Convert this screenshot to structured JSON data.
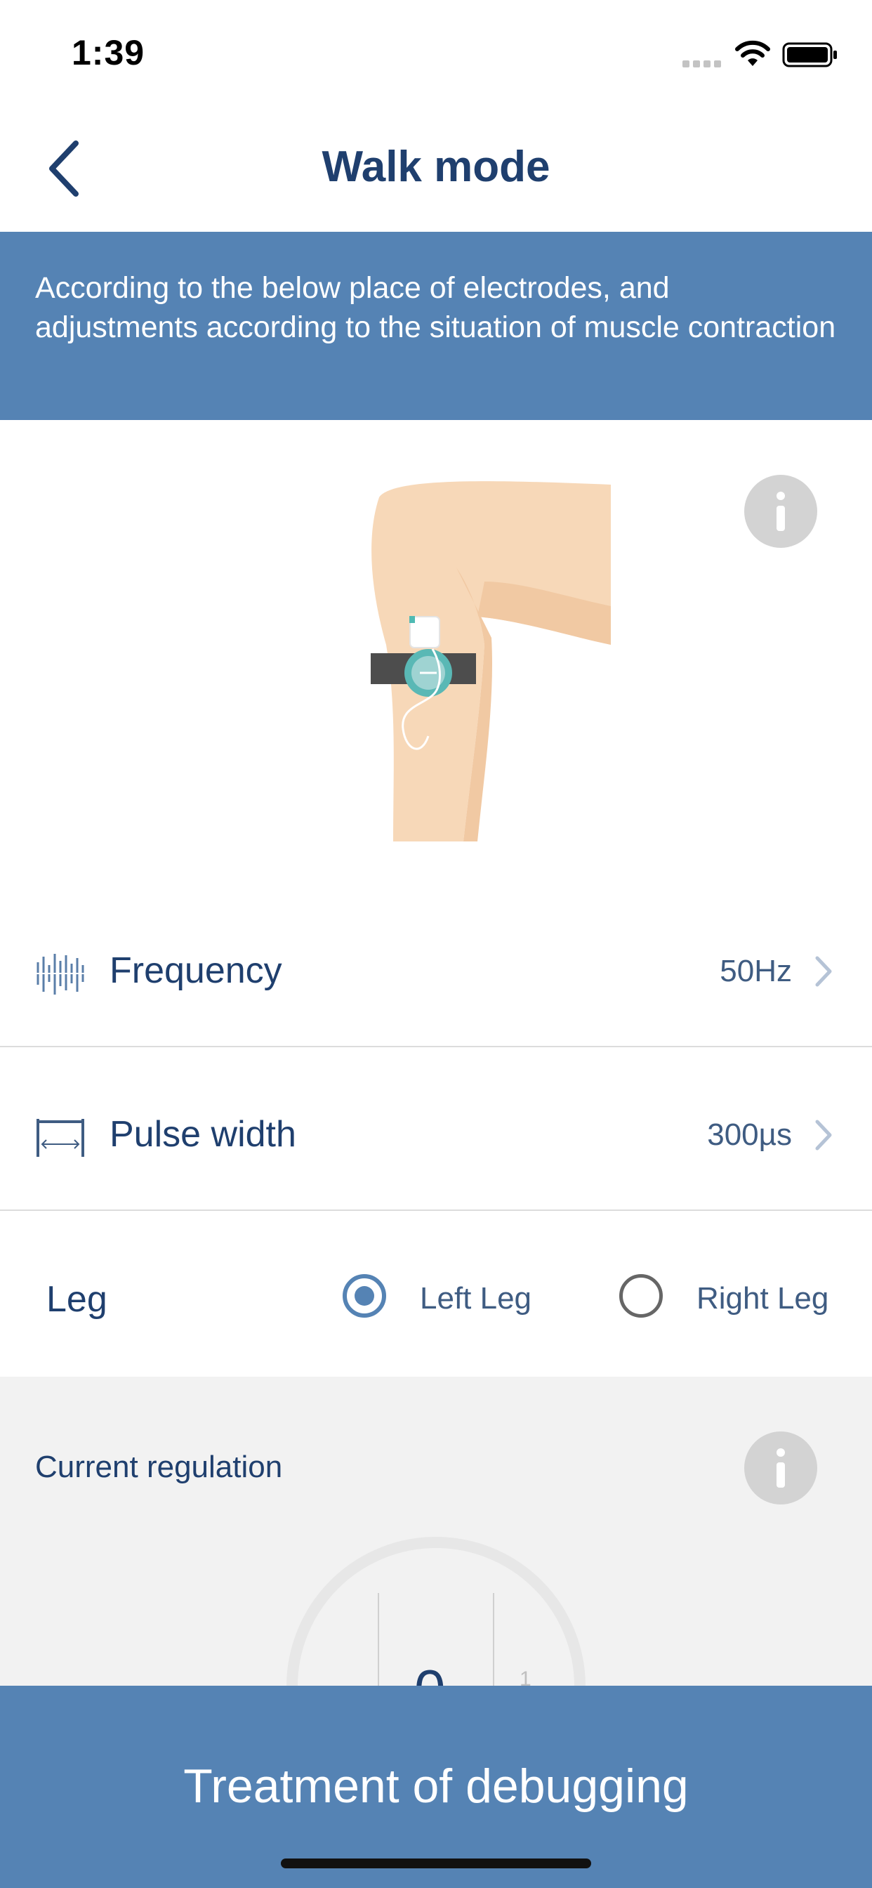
{
  "status_bar": {
    "time": "1:39"
  },
  "nav": {
    "title": "Walk mode",
    "back_icon": "chevron-left-icon"
  },
  "banner": {
    "text": "According to the below place of electrodes, and adjustments according to the situation of muscle contraction"
  },
  "illustration": {
    "icon": "leg-electrode-illustration",
    "info_icon": "info-icon"
  },
  "settings": [
    {
      "icon": "frequency-icon",
      "label": "Frequency",
      "value": "50Hz",
      "chevron": "chevron-right-icon"
    },
    {
      "icon": "pulse-width-icon",
      "label": "Pulse width",
      "value": "300µs",
      "chevron": "chevron-right-icon"
    }
  ],
  "leg": {
    "label": "Leg",
    "options": [
      {
        "label": "Left Leg",
        "selected": true
      },
      {
        "label": "Right Leg",
        "selected": false
      }
    ]
  },
  "current_regulation": {
    "title": "Current regulation",
    "value": "0",
    "next_value": "1",
    "info_icon": "info-icon"
  },
  "cta": {
    "label": "Treatment of debugging"
  },
  "colors": {
    "accent": "#5583b4",
    "text_primary": "#1f3f6e",
    "panel_bg": "#f2f2f2"
  }
}
